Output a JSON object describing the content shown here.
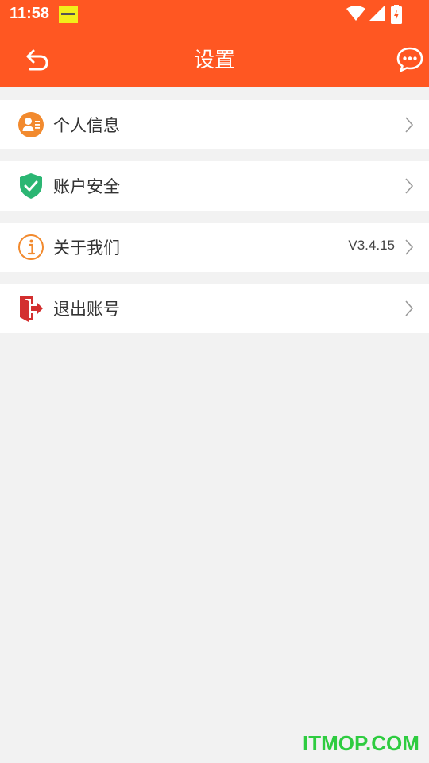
{
  "status_bar": {
    "time": "11:58",
    "notification_icon": "app-notification-icon",
    "icons": [
      "wifi-icon",
      "signal-icon",
      "battery-icon"
    ]
  },
  "header": {
    "title": "设置",
    "back_icon": "back-arrow-icon",
    "message_icon": "chat-bubble-icon",
    "background_color": "#ff5722"
  },
  "settings": {
    "items": [
      {
        "label": "个人信息",
        "icon": "personal-info-icon",
        "value": ""
      },
      {
        "label": "账户安全",
        "icon": "shield-check-icon",
        "value": ""
      },
      {
        "label": "关于我们",
        "icon": "info-icon",
        "value": "V3.4.15"
      },
      {
        "label": "退出账号",
        "icon": "logout-door-icon",
        "value": ""
      }
    ]
  },
  "watermark": "ITMOP.COM"
}
